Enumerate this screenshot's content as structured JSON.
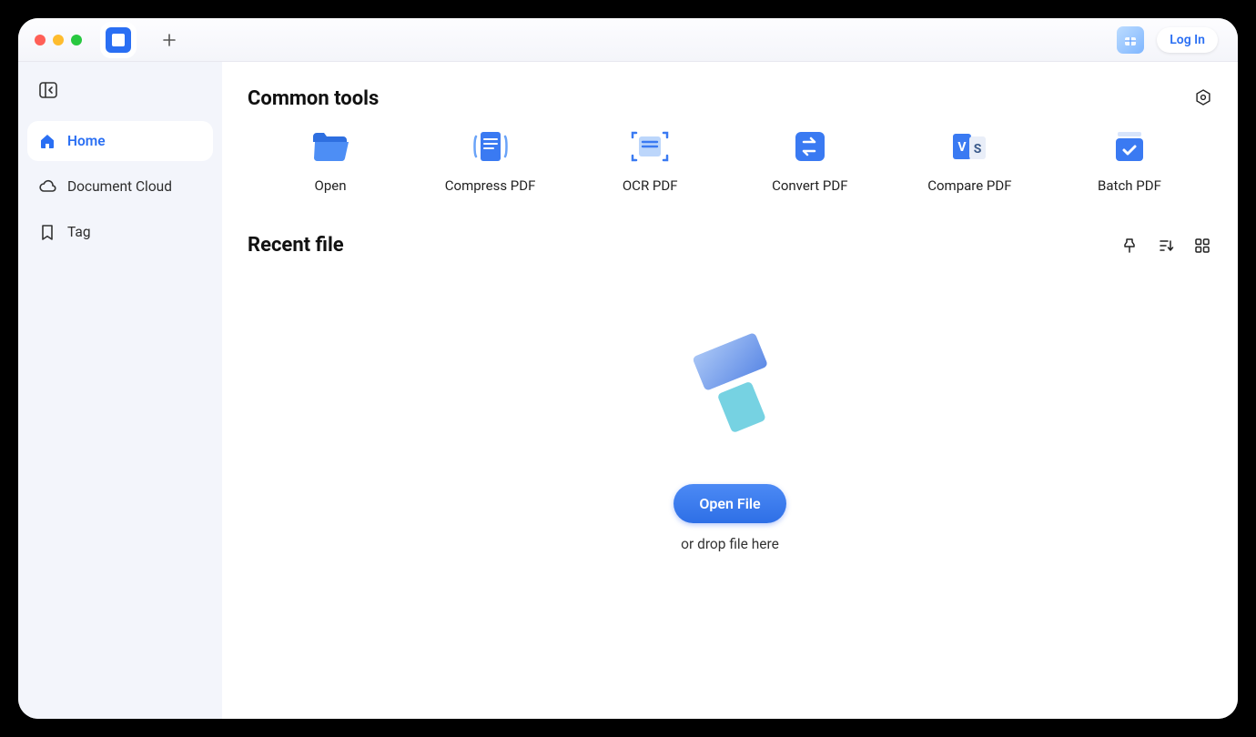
{
  "titlebar": {
    "login_label": "Log In"
  },
  "sidebar": {
    "items": [
      {
        "label": "Home"
      },
      {
        "label": "Document Cloud"
      },
      {
        "label": "Tag"
      }
    ]
  },
  "main": {
    "common_tools_title": "Common tools",
    "tools": [
      {
        "label": "Open"
      },
      {
        "label": "Compress PDF"
      },
      {
        "label": "OCR PDF"
      },
      {
        "label": "Convert PDF"
      },
      {
        "label": "Compare PDF"
      },
      {
        "label": "Batch PDF"
      }
    ],
    "recent_title": "Recent file",
    "open_file_label": "Open File",
    "drop_hint": "or drop file here"
  }
}
